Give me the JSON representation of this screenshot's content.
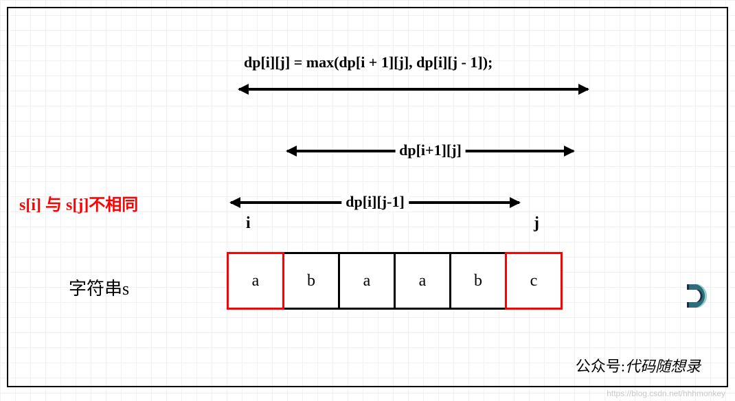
{
  "formula": "dp[i][j] = max(dp[i + 1][j], dp[i][j - 1]);",
  "arrows": {
    "a2_label": "dp[i+1][j]",
    "a3_label": "dp[i][j-1]"
  },
  "pointers": {
    "i": "i",
    "j": "j"
  },
  "condition_text": "s[i] 与 s[j]不相同",
  "string_label": "字符串s",
  "cells": [
    "a",
    "b",
    "a",
    "a",
    "b",
    "c"
  ],
  "credit": {
    "label": "公众号:",
    "name": "代码随想录"
  },
  "watermark_url": "https://blog.csdn.net/hhhmonkey"
}
